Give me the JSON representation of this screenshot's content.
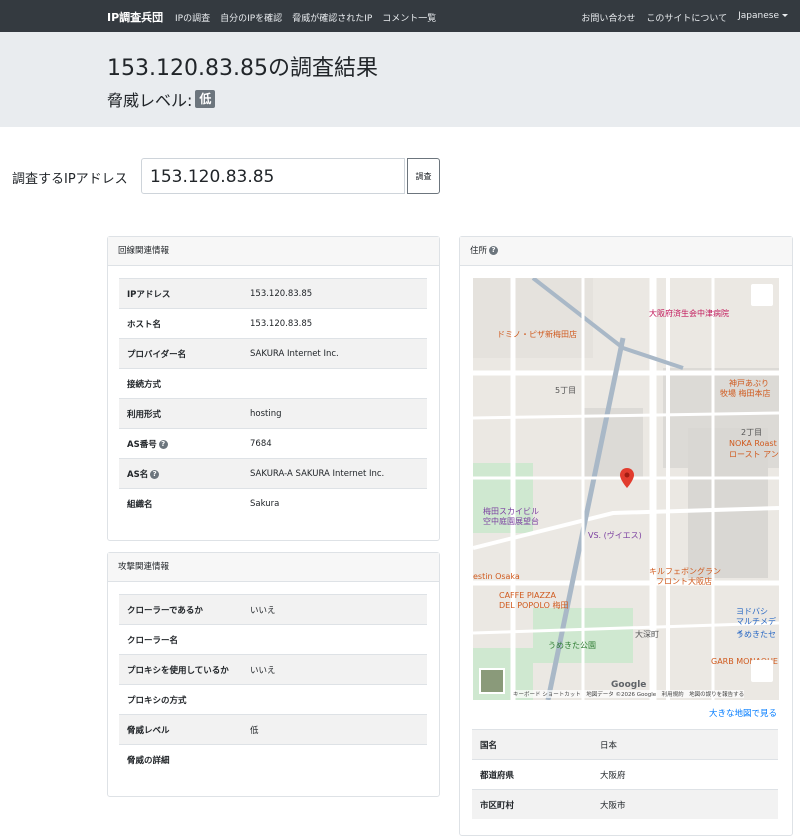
{
  "navbar": {
    "brand": "IP調査兵団",
    "links": [
      "IPの調査",
      "自分のIPを確認",
      "脅威が確認されたIP",
      "コメント一覧"
    ],
    "right_links": [
      "お問い合わせ",
      "このサイトについて"
    ],
    "language": "Japanese"
  },
  "header": {
    "title": "153.120.83.85の調査結果",
    "threat_label": "脅威レベル:",
    "threat_value": "低"
  },
  "search": {
    "label": "調査するIPアドレス",
    "value": "153.120.83.85",
    "button": "調査"
  },
  "line_info": {
    "title": "回線関連情報",
    "rows": [
      {
        "key": "IPアドレス",
        "value": "153.120.83.85",
        "help": false
      },
      {
        "key": "ホスト名",
        "value": "153.120.83.85",
        "help": false
      },
      {
        "key": "プロバイダー名",
        "value": "SAKURA Internet Inc.",
        "help": false
      },
      {
        "key": "接続方式",
        "value": "",
        "help": false
      },
      {
        "key": "利用形式",
        "value": "hosting",
        "help": false
      },
      {
        "key": "AS番号",
        "value": "7684",
        "help": true
      },
      {
        "key": "AS名",
        "value": "SAKURA-A SAKURA Internet Inc.",
        "help": true
      },
      {
        "key": "組織名",
        "value": "Sakura",
        "help": false
      }
    ]
  },
  "attack_info": {
    "title": "攻撃関連情報",
    "rows": [
      {
        "key": "クローラーであるか",
        "value": "いいえ"
      },
      {
        "key": "クローラー名",
        "value": ""
      },
      {
        "key": "プロキシを使用しているか",
        "value": "いいえ"
      },
      {
        "key": "プロキシの方式",
        "value": ""
      },
      {
        "key": "脅威レベル",
        "value": "低"
      },
      {
        "key": "脅威の詳細",
        "value": ""
      }
    ]
  },
  "address": {
    "title": "住所",
    "map_labels": {
      "domino": "ドミノ・ピザ新梅田店",
      "osaka_health": "大阪府済生会中津病院",
      "kobe": "神戸あぶり",
      "kobe2": "牧場 梅田本店",
      "noka": "NOKA Roast",
      "noka2": "ロースト アン",
      "umeda_sky": "梅田スカイビル",
      "umeda_sky2": "空中庭園展望台",
      "vs": "VS. (ヴイエス)",
      "kill": "キルフェボングラン",
      "kill2": "フロント大阪店",
      "caffe": "CAFFE PIAZZA",
      "caffe2": "DEL POPOLO 梅田",
      "umekita": "うめきた公園",
      "yodobashi": "ヨドバシ",
      "yodobashi2": "マルチメディ",
      "umekita_se": "うめきたセ",
      "garb": "GARB MONAQUE",
      "westin": "estin Osaka",
      "chome5": "5丁目",
      "chome2": "2丁目",
      "oyodo": "大深町",
      "google": "Google",
      "attribution": "キーボード ショートカット　地図データ ©2026 Google　利用規約　地図の誤りを報告する"
    },
    "map_link": "大きな地図で見る",
    "rows": [
      {
        "key": "国名",
        "value": "日本"
      },
      {
        "key": "都道府県",
        "value": "大阪府"
      },
      {
        "key": "市区町村",
        "value": "大阪市"
      }
    ]
  }
}
